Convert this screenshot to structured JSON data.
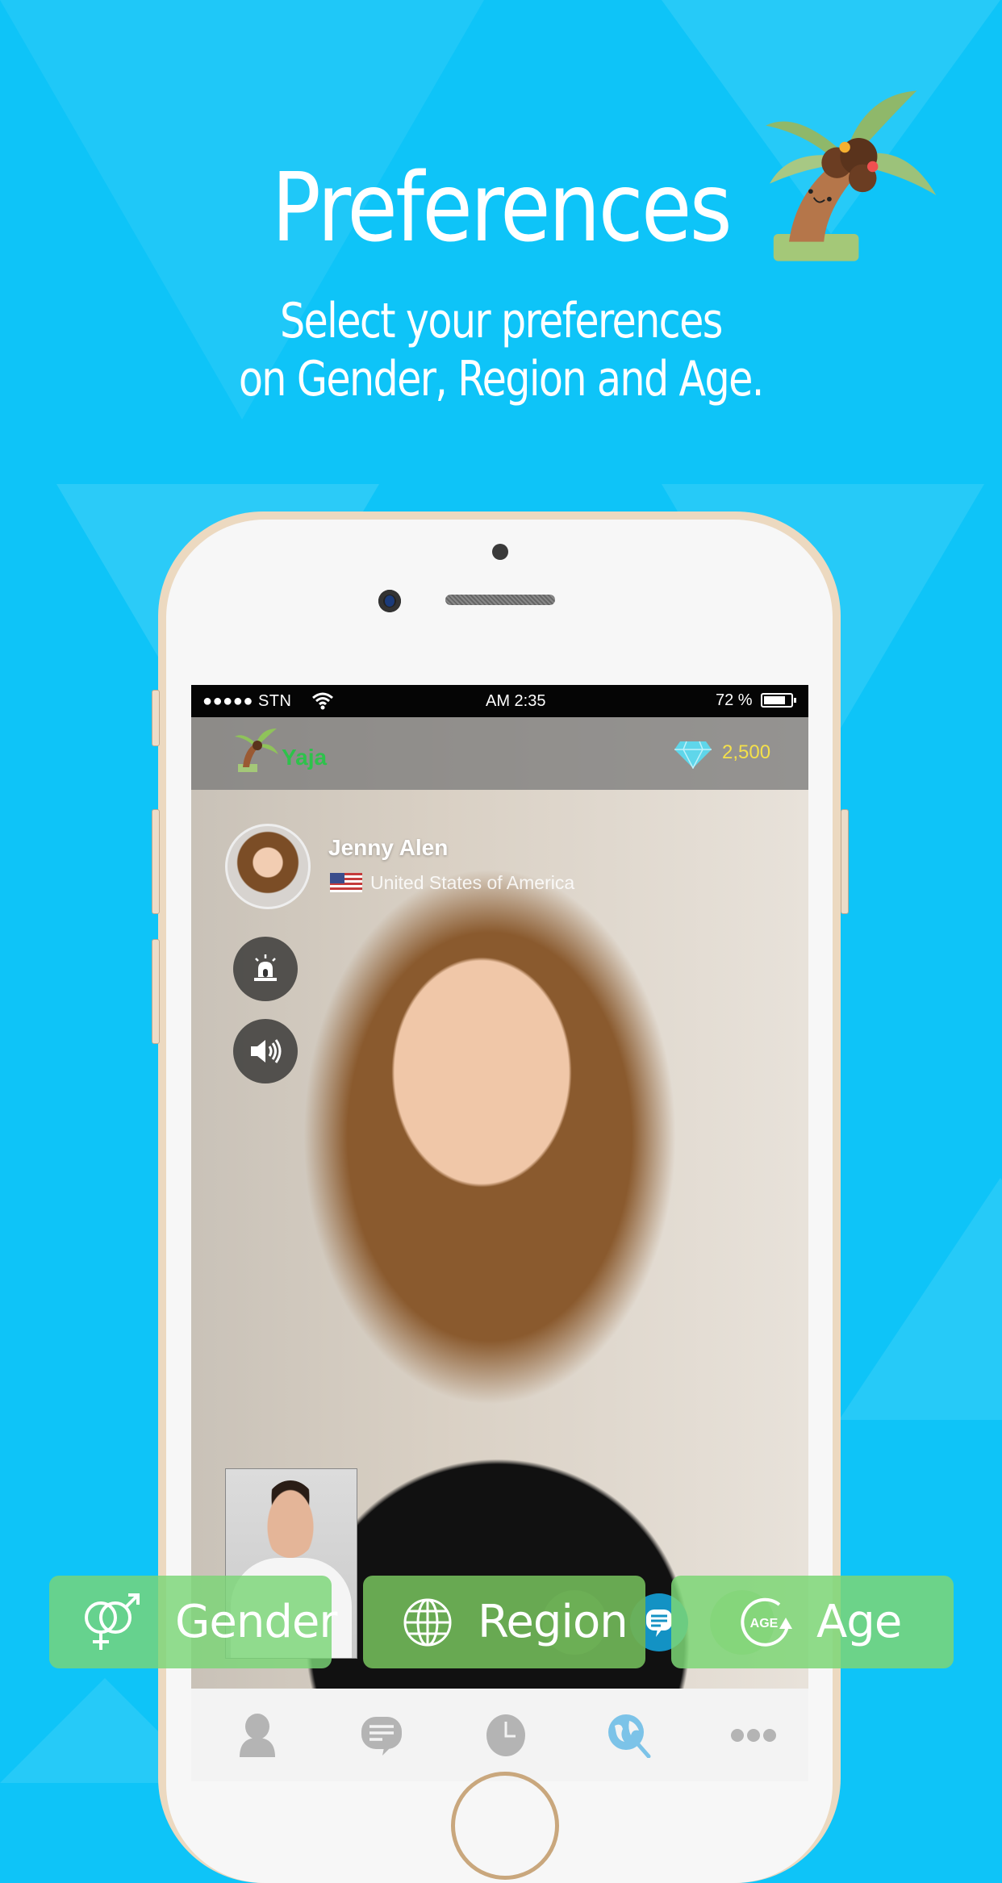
{
  "banner": {
    "title": "Preferences",
    "subtitle_line1": "Select your preferences",
    "subtitle_line2": "on Gender, Region and  Age."
  },
  "status_bar": {
    "carrier": "●●●●● STN",
    "time": "AM 2:35",
    "battery_percent": "72 %",
    "battery_level": 0.72
  },
  "app_header": {
    "app_name": "Yaja",
    "gem_count": "2,500"
  },
  "profile": {
    "name": "Jenny Alen",
    "country": "United States of America",
    "flag_icon": "us-flag-icon"
  },
  "side_actions": [
    {
      "name": "report-siren-icon"
    },
    {
      "name": "speaker-volume-icon"
    }
  ],
  "preference_buttons": [
    {
      "label": "Gender",
      "icon": "gender-icon"
    },
    {
      "label": "Region",
      "icon": "globe-icon"
    },
    {
      "label": "Age",
      "icon": "age-icon"
    }
  ],
  "tab_bar": [
    {
      "name": "profile",
      "icon": "person-icon",
      "active": false
    },
    {
      "name": "chat",
      "icon": "chat-icon",
      "active": false
    },
    {
      "name": "history",
      "icon": "clock-icon",
      "active": false
    },
    {
      "name": "discover",
      "icon": "globe-search-icon",
      "active": true
    },
    {
      "name": "more",
      "icon": "more-dots-icon",
      "active": false
    }
  ],
  "colors": {
    "background": "#0ec4f8",
    "pref_button_green": "#6ccf7f",
    "app_name_green": "#2ec24b",
    "gem_yellow": "#f4e04a",
    "tab_active": "#7cc3e8",
    "tab_inactive": "#b4b4b4"
  }
}
